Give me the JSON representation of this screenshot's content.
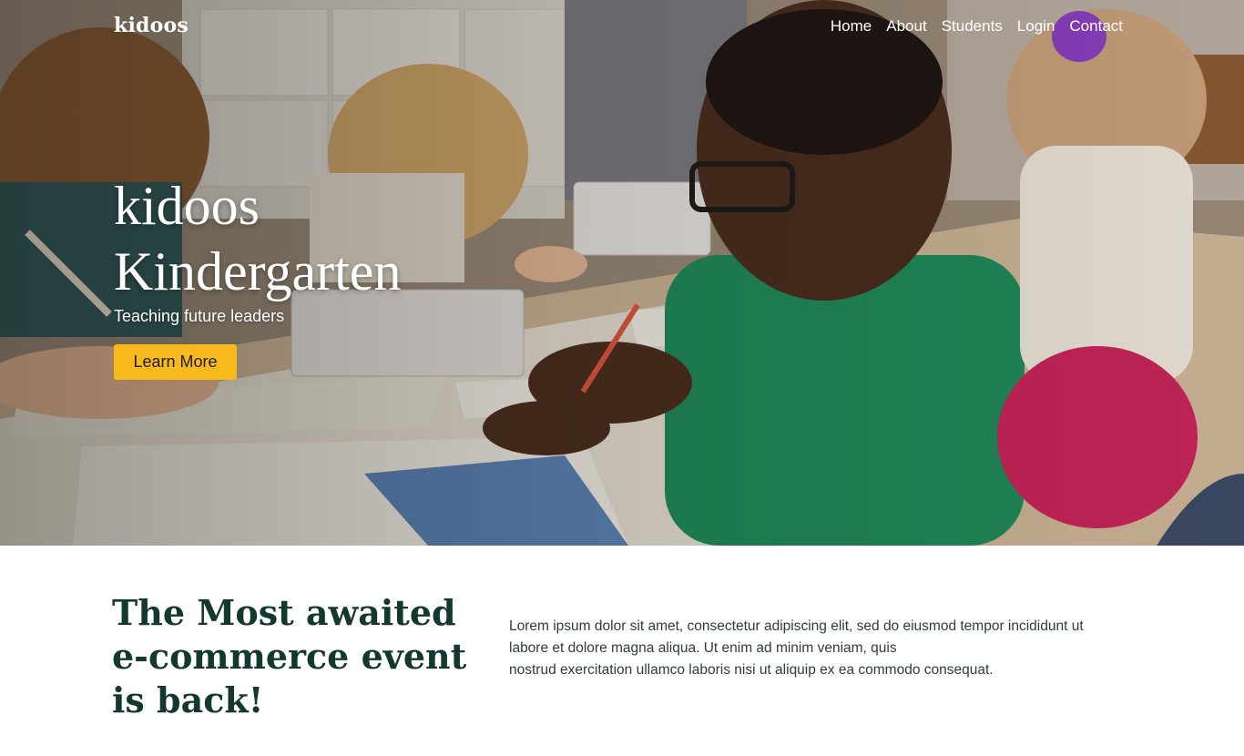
{
  "header": {
    "logo": "kidoos",
    "nav": [
      "Home",
      "About",
      "Students",
      "Login",
      "Contact"
    ]
  },
  "hero": {
    "title_lines": [
      "kidoos",
      "Kindergarten"
    ],
    "subtitle": "Teaching future leaders",
    "cta_label": "Learn More",
    "image_description": "children-drawing-at-classroom-table"
  },
  "event_section": {
    "heading_lines": [
      "The Most awaited",
      "e-commerce event",
      "is back!"
    ],
    "body_lines": [
      "Lorem ipsum dolor sit amet, consectetur adipiscing elit, sed do eiusmod tempor incididunt ut",
      "labore et dolore magna aliqua. Ut enim ad minim veniam, quis",
      "nostrud exercitation ullamco laboris nisi ut aliquip ex ea commodo consequat."
    ]
  },
  "colors": {
    "accent": "#f7b91c",
    "heading": "#13382f",
    "body_text": "#333a3a"
  }
}
